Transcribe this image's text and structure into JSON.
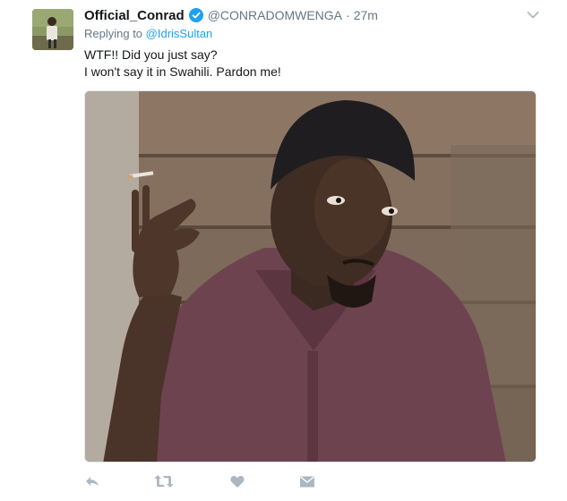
{
  "author": {
    "display_name": "Official_Conrad",
    "handle": "@CONRADOMWENGA",
    "separator": "·",
    "time": "27m"
  },
  "reply": {
    "prefix": "Replying to ",
    "mention": "@IdrisSultan"
  },
  "tweet": {
    "line1": "WTF!! Did you just say?",
    "line2": "I won't say it in Swahili. Pardon me!"
  },
  "icons": {
    "verified": "verified-badge-icon",
    "caret": "chevron-down-icon",
    "reply": "reply-icon",
    "retweet": "retweet-icon",
    "like": "heart-icon",
    "dm": "direct-message-icon"
  },
  "colors": {
    "link": "#1da1f2",
    "muted": "#657786",
    "icon": "#aab8c2",
    "text": "#14171a"
  }
}
